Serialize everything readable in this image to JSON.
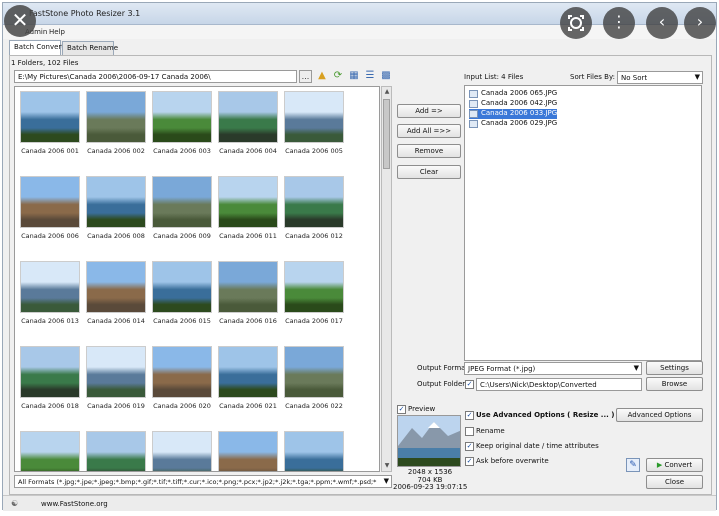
{
  "window": {
    "title": "FastStone Photo Resizer 3.1",
    "menu": [
      "Admin",
      "Help"
    ],
    "tabs": [
      "Batch Convert",
      "Batch Rename"
    ]
  },
  "browser": {
    "summary": "1 Folders, 102 Files",
    "path": "E:\\My Pictures\\Canada 2006\\2006-09-17 Canada 2006\\",
    "browse_btn": "...",
    "thumbnails": [
      "Canada 2006 001",
      "Canada 2006 002",
      "Canada 2006 003",
      "Canada 2006 004",
      "Canada 2006 005",
      "Canada 2006 006",
      "Canada 2006 008",
      "Canada 2006 009",
      "Canada 2006 011",
      "Canada 2006 012",
      "Canada 2006 013",
      "Canada 2006 014",
      "Canada 2006 015",
      "Canada 2006 016",
      "Canada 2006 017",
      "Canada 2006 018",
      "Canada 2006 019",
      "Canada 2006 020",
      "Canada 2006 021",
      "Canada 2006 022",
      "",
      "",
      "",
      "",
      ""
    ],
    "filter": "All Formats (*.jpg;*.jpe;*.jpeg;*.bmp;*.gif;*.tif;*.tiff;*.cur;*.ico;*.png;*.pcx;*.jp2;*.j2k;*.tga;*.ppm;*.wmf;*.psd;*"
  },
  "actions": {
    "add": "Add =>",
    "add_all": "Add All =>>",
    "remove": "Remove",
    "clear": "Clear"
  },
  "input_list": {
    "label": "Input List:  4 Files",
    "sort_label": "Sort Files By:",
    "sort_value": "No Sort",
    "files": [
      "Canada 2006 065.JPG",
      "Canada 2006 042.JPG",
      "Canada 2006 033.JPG",
      "Canada 2006 029.JPG"
    ],
    "selected_index": 2
  },
  "output": {
    "format_label": "Output Format:",
    "format_value": "JPEG Format (*.jpg)",
    "settings_btn": "Settings",
    "folder_label": "Output Folder:",
    "folder_value": "C:\\Users\\Nick\\Desktop\\Converted",
    "browse_btn": "Browse"
  },
  "options": {
    "preview_label": "Preview",
    "use_advanced": "Use Advanced Options ( Resize ... )",
    "advanced_btn": "Advanced Options",
    "rename": "Rename",
    "keep_date": "Keep original date / time attributes",
    "ask_overwrite": "Ask before overwrite",
    "preview_dims": "2048 x 1536",
    "preview_size": "704 KB",
    "preview_date": "2006-09-23 19:07:15"
  },
  "buttons": {
    "convert": "Convert",
    "close": "Close"
  },
  "status": {
    "url": "www.FastStone.org"
  }
}
